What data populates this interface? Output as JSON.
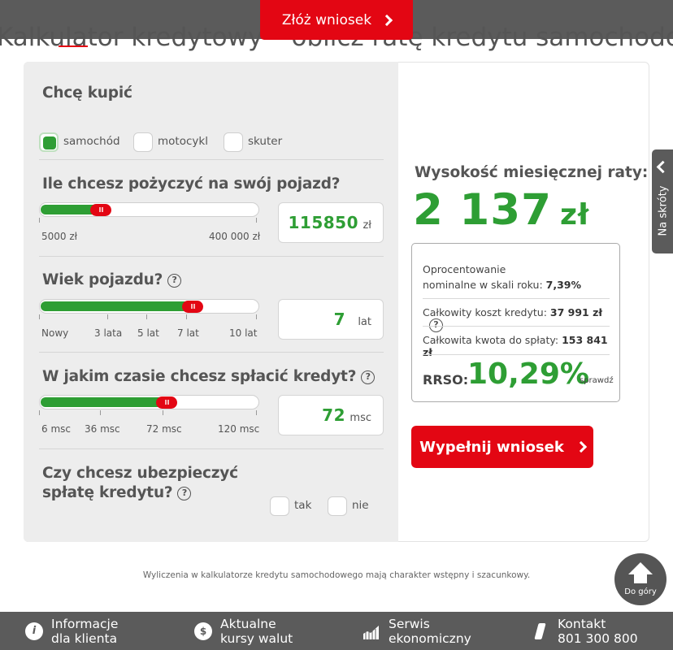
{
  "header": {
    "apply_label": "Złóż wniosek",
    "page_title": "Kalkulator kredytowy – oblicz ratę kredytu samochodowego"
  },
  "purchase": {
    "heading": "Chcę kupić",
    "options": [
      {
        "label": "samochód",
        "checked": true
      },
      {
        "label": "motocykl",
        "checked": false
      },
      {
        "label": "skuter",
        "checked": false
      }
    ]
  },
  "loan_amount": {
    "heading": "Ile chcesz pożyczyć na swój pojazd?",
    "value": "115850",
    "unit": "zł",
    "min_label": "5000 zł",
    "max_label": "400 000 zł",
    "slider_fraction": 0.28
  },
  "vehicle_age": {
    "heading": "Wiek pojazdu?",
    "value": "7",
    "unit": "lat",
    "tick_labels": [
      "Nowy",
      "3 lata",
      "5 lat",
      "7 lat",
      "10 lat"
    ],
    "slider_fraction": 0.7
  },
  "repayment": {
    "heading": "W jakim czasie chcesz spłacić kredyt?",
    "value": "72",
    "unit": "msc",
    "tick_labels": [
      "6 msc",
      "36 msc",
      "72 msc",
      "120 msc"
    ],
    "slider_fraction": 0.58
  },
  "insurance": {
    "heading_line1": "Czy chcesz ubezpieczyć",
    "heading_line2": "spłatę kredytu?",
    "options": [
      {
        "label": "tak",
        "checked": false
      },
      {
        "label": "nie",
        "checked": false
      }
    ]
  },
  "result": {
    "rate_label": "Wysokość miesięcznej raty:",
    "rate_value": "2 137",
    "rate_unit": "zł",
    "interest_label_line1": "Oprocentowanie",
    "interest_label_line2": "nominalne w skali roku:",
    "interest_value": "7,39%",
    "total_cost_label": "Całkowity koszt kredytu:",
    "total_cost_value": "37 991 zł",
    "total_amount_label": "Całkowita kwota do spłaty:",
    "total_amount_value": "153 841 zł",
    "rrso_label": "RRSO:",
    "rrso_value": "10,29%",
    "check_link": "sprawdź",
    "apply_label": "Wypełnij wniosek"
  },
  "side_tab": {
    "label": "Na skróty"
  },
  "disclaimer": "Wyliczenia w kalkulatorze kredytu samochodowego mają charakter wstępny i szacunkowy.",
  "back_to_top": {
    "label": "Do góry"
  },
  "footer": [
    {
      "line1": "Informacje",
      "line2": "dla klienta",
      "icon": "info-icon"
    },
    {
      "line1": "Aktualne",
      "line2": "kursy walut",
      "icon": "dollar-icon"
    },
    {
      "line1": "Serwis",
      "line2": "ekonomiczny",
      "icon": "chart-icon"
    },
    {
      "line1": "Kontakt",
      "line2": "801 300 800",
      "icon": "phone-icon"
    }
  ],
  "colors": {
    "accent_red": "#e30613",
    "accent_green": "#2e9e34",
    "panel_grey": "#ededed",
    "bar_grey": "#5b5b5b"
  }
}
